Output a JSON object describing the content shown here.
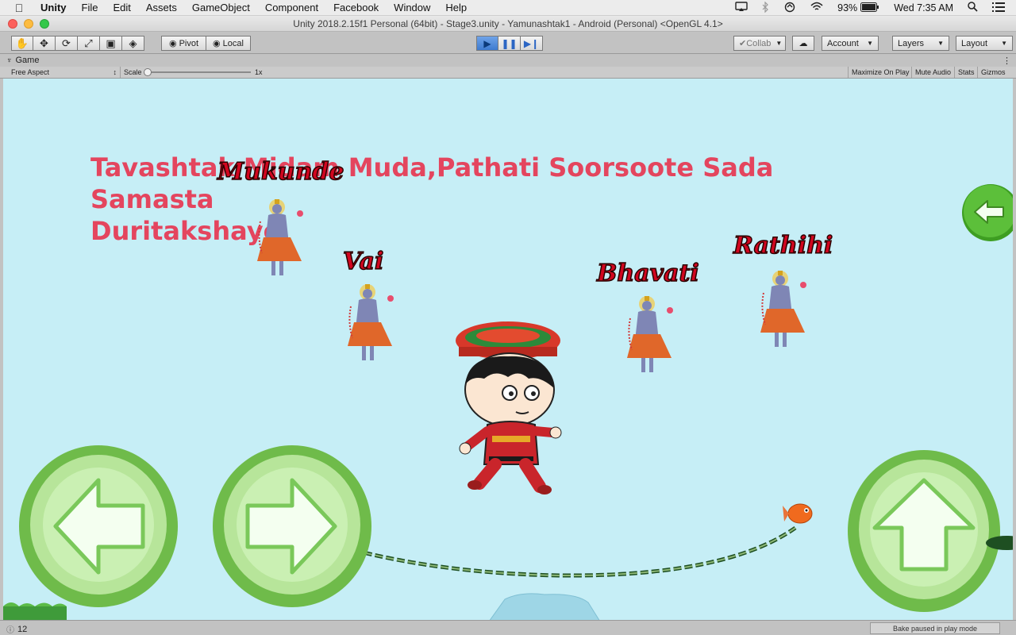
{
  "menubar": {
    "app": "Unity",
    "items": [
      "File",
      "Edit",
      "Assets",
      "GameObject",
      "Component",
      "Facebook",
      "Window",
      "Help"
    ],
    "battery": "93%",
    "clock": "Wed 7:35 AM"
  },
  "window": {
    "title": "Unity 2018.2.15f1 Personal (64bit) - Stage3.unity - Yamunashtak1 - Android (Personal) <OpenGL 4.1>"
  },
  "toolbar": {
    "pivot_label": "Pivot",
    "local_label": "Local",
    "collab_label": "Collab",
    "account_label": "Account",
    "layers_label": "Layers",
    "layout_label": "Layout"
  },
  "game_panel": {
    "tab_label": "Game",
    "aspect": "Free Aspect",
    "scale_label": "Scale",
    "scale_value": "1x",
    "scale_fraction": 0.0,
    "maximize_on_play": "Maximize On Play",
    "mute_audio": "Mute Audio",
    "stats": "Stats",
    "gizmos": "Gizmos"
  },
  "game": {
    "hint_line1": "Tavashtak Midam Muda,Pathati Soorsoote Sada Samasta",
    "hint_line2": "Duritakshayo",
    "words": [
      "Mukunde",
      "Vai",
      "Bhavati",
      "Rathihi"
    ],
    "colors": {
      "sky": "#c6eef6",
      "hint_text": "#e4455e",
      "word_text": "#d1061f",
      "button_green": "#8bcf6a",
      "back_green": "#5cbf3a"
    }
  },
  "statusbar": {
    "count": "12",
    "bake_status": "Bake paused in play mode"
  }
}
